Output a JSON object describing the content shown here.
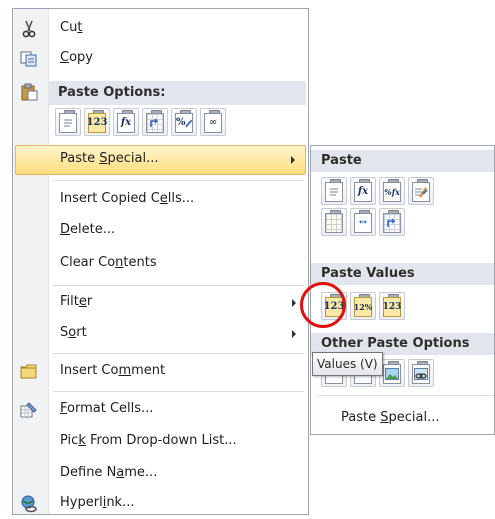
{
  "main_menu": {
    "cut": {
      "pre": "Cu",
      "accel": "t",
      "post": "",
      "icon": "scissors-icon"
    },
    "copy": {
      "pre": "",
      "accel": "C",
      "post": "opy",
      "icon": "copy-icon"
    },
    "paste_options_title": "Paste Options:",
    "paste_options_buttons": [
      {
        "name": "paste",
        "glyph": ""
      },
      {
        "name": "values",
        "glyph": "123"
      },
      {
        "name": "formulas",
        "glyph": "fx"
      },
      {
        "name": "transpose",
        "glyph": ""
      },
      {
        "name": "formatting",
        "glyph": "%"
      },
      {
        "name": "paste-link",
        "glyph": "∞"
      }
    ],
    "paste_special": {
      "pre": "Paste ",
      "accel": "S",
      "post": "pecial..."
    },
    "insert_copied_cells": {
      "pre": "Insert Copied C",
      "accel": "e",
      "post": "lls..."
    },
    "delete": {
      "pre": "",
      "accel": "D",
      "post": "elete..."
    },
    "clear_contents": {
      "pre": "Clear Co",
      "accel": "n",
      "post": "tents"
    },
    "filter": {
      "pre": "Filt",
      "accel": "e",
      "post": "r"
    },
    "sort": {
      "pre": "S",
      "accel": "o",
      "post": "rt"
    },
    "insert_comment": {
      "pre": "Insert Co",
      "accel": "m",
      "post": "ment",
      "icon": "comment-icon"
    },
    "format_cells": {
      "pre": "",
      "accel": "F",
      "post": "ormat Cells...",
      "icon": "format-cells-icon"
    },
    "pick_from_list": {
      "pre": "Pic",
      "accel": "k",
      "post": " From Drop-down List..."
    },
    "define_name": {
      "pre": "Define N",
      "accel": "a",
      "post": "me..."
    },
    "hyperlink": {
      "pre": "Hyperl",
      "accel": "i",
      "post": "nk...",
      "icon": "hyperlink-icon"
    }
  },
  "submenu": {
    "paste_title": "Paste",
    "paste_values_title": "Paste Values",
    "other_title": "Other Paste Options",
    "paste_buttons": [
      {
        "name": "paste",
        "glyph": ""
      },
      {
        "name": "formulas",
        "glyph": "fx"
      },
      {
        "name": "formulas-number-formatting",
        "glyph": "%fx"
      },
      {
        "name": "keep-source-formatting",
        "glyph": ""
      },
      {
        "name": "no-borders",
        "glyph": ""
      },
      {
        "name": "keep-column-widths",
        "glyph": "↔"
      },
      {
        "name": "transpose",
        "glyph": ""
      }
    ],
    "values_buttons": [
      {
        "name": "values",
        "glyph": "123"
      },
      {
        "name": "values-number-formatting",
        "glyph": "12%"
      },
      {
        "name": "values-source-formatting",
        "glyph": "123"
      }
    ],
    "other_buttons": [
      {
        "name": "formatting",
        "glyph": "%"
      },
      {
        "name": "paste-link",
        "glyph": "∞"
      },
      {
        "name": "picture",
        "glyph": ""
      },
      {
        "name": "linked-picture",
        "glyph": "∞"
      }
    ],
    "paste_special": {
      "pre": "Paste ",
      "accel": "S",
      "post": "pecial..."
    }
  },
  "tooltip": "Values (V)",
  "colors": {
    "highlight": "#fedd7d",
    "ring": "#e01010"
  }
}
